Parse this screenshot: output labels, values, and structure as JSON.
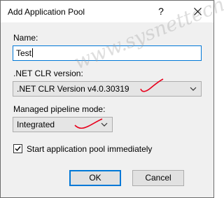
{
  "dialog": {
    "title": "Add Application Pool",
    "help_glyph": "?"
  },
  "name": {
    "label": "Name:",
    "value": "Test"
  },
  "clr": {
    "label": ".NET CLR version:",
    "selected": ".NET CLR Version v4.0.30319"
  },
  "pipeline": {
    "label": "Managed pipeline mode:",
    "selected": "Integrated"
  },
  "start": {
    "label": "Start application pool immediately",
    "checked": true
  },
  "buttons": {
    "ok": "OK",
    "cancel": "Cancel"
  },
  "watermark": "www.sysnettech.com",
  "colors": {
    "focus_border": "#0078d7",
    "annotation_red": "#e8001c"
  }
}
